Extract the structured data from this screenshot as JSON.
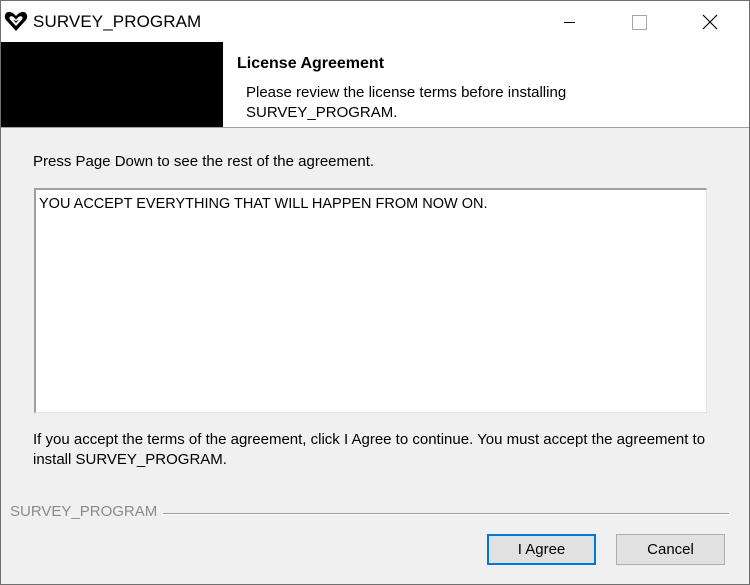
{
  "window": {
    "title": "SURVEY_PROGRAM",
    "app_icon": "heart-shield-icon",
    "controls": {
      "minimize_icon": "minimize-icon",
      "maximize_icon": "maximize-icon",
      "close_icon": "close-icon"
    }
  },
  "header": {
    "title": "License Agreement",
    "subtitle": "Please review the license terms before installing SURVEY_PROGRAM."
  },
  "main": {
    "instruction": "Press Page Down to see the rest of the agreement.",
    "license_text": "YOU ACCEPT EVERYTHING THAT WILL HAPPEN FROM NOW ON.",
    "accept_note": "If you accept the terms of the agreement, click I Agree to continue. You must accept the agreement to install SURVEY_PROGRAM."
  },
  "footer": {
    "branding": "SURVEY_PROGRAM",
    "agree_label": "I Agree",
    "cancel_label": "Cancel"
  },
  "colors": {
    "dialog_background": "#f0f0f0",
    "banner_background": "#ffffff",
    "banner_image": "#000000",
    "focus_border": "#0078d7",
    "branding_text": "#8a8a8a"
  }
}
